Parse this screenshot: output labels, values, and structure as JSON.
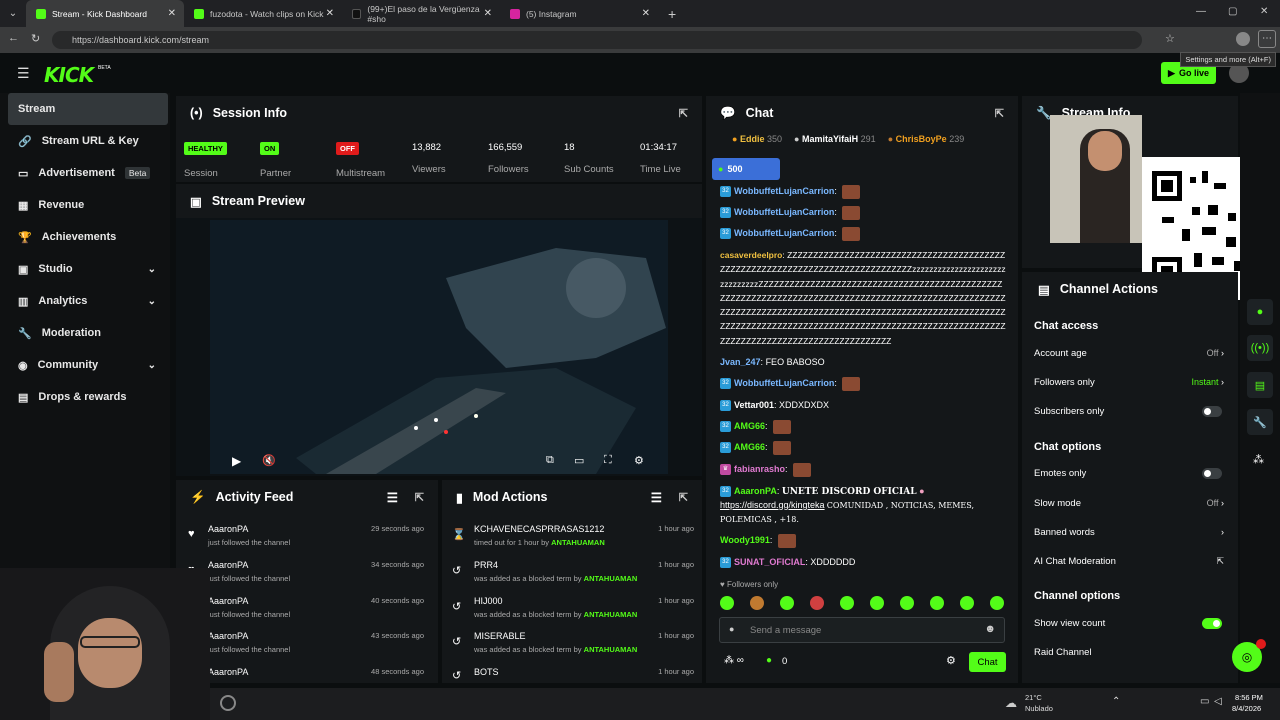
{
  "browser": {
    "tabs": [
      {
        "title": "Stream - Kick Dashboard",
        "color": "#53fc18",
        "active": true
      },
      {
        "title": "fuzodota - Watch clips on Kick",
        "color": "#53fc18",
        "active": false
      },
      {
        "title": "(99+)El paso de la Vergüenza #sho",
        "color": "#111111",
        "active": false
      },
      {
        "title": "(5) Instagram",
        "color": "#d6249f",
        "active": false
      }
    ],
    "url": "https://dashboard.kick.com/stream",
    "tooltip": "Settings and more (Alt+F)"
  },
  "topnav": {
    "logo": "KICK",
    "logo_sup": "BETA",
    "golive": "Go live"
  },
  "sidebar": {
    "items": [
      {
        "label": "Stream",
        "icon": "broadcast-icon",
        "active": true
      },
      {
        "label": "Stream URL & Key",
        "icon": "link-icon"
      },
      {
        "label": "Advertisement",
        "badge": "Beta",
        "icon": "ad-icon"
      },
      {
        "label": "Revenue",
        "icon": "revenue-icon"
      },
      {
        "label": "Achievements",
        "icon": "trophy-icon"
      },
      {
        "label": "Studio",
        "icon": "studio-icon",
        "chevron": true
      },
      {
        "label": "Analytics",
        "icon": "chart-icon",
        "chevron": true
      },
      {
        "label": "Moderation",
        "icon": "wrench-icon"
      },
      {
        "label": "Community",
        "icon": "community-icon",
        "chevron": true
      },
      {
        "label": "Drops & rewards",
        "icon": "gift-icon"
      }
    ]
  },
  "session": {
    "title": "Session Info",
    "session_pill": "HEALTHY",
    "session_label": "Session",
    "partner_pill": "ON",
    "partner_label": "Partner",
    "multistream_pill": "OFF",
    "multistream_label": "Multistream",
    "viewers": "13,882",
    "viewers_label": "Viewers",
    "followers": "166,559",
    "followers_label": "Followers",
    "subs": "18",
    "subs_label": "Sub Counts",
    "time": "01:34:17",
    "time_label": "Time Live"
  },
  "preview": {
    "title": "Stream Preview"
  },
  "activity": {
    "title": "Activity Feed",
    "rows": [
      {
        "name": "AaaronPA",
        "sub": "just followed the channel",
        "time": "29 seconds ago"
      },
      {
        "name": "AaaronPA",
        "sub": "just followed the channel",
        "time": "34 seconds ago"
      },
      {
        "name": "AaaronPA",
        "sub": "just followed the channel",
        "time": "40 seconds ago"
      },
      {
        "name": "AaaronPA",
        "sub": "just followed the channel",
        "time": "43 seconds ago"
      },
      {
        "name": "AaaronPA",
        "sub": "",
        "time": "48 seconds ago"
      }
    ]
  },
  "mod": {
    "title": "Mod Actions",
    "by": "ANTAHUAMAN",
    "rows": [
      {
        "name": "KCHAVENECASPRRASAS1212",
        "sub": "timed out for 1 hour by",
        "time": "1 hour ago"
      },
      {
        "name": "PRR4",
        "sub": "was added as a blocked term by",
        "time": "1 hour ago"
      },
      {
        "name": "HIJ000",
        "sub": "was added as a blocked term by",
        "time": "1 hour ago"
      },
      {
        "name": "MISERABLE",
        "sub": "was added as a blocked term by",
        "time": "1 hour ago"
      },
      {
        "name": "BOTS",
        "sub": "",
        "time": "1 hour ago"
      }
    ]
  },
  "chat": {
    "title": "Chat",
    "top": [
      {
        "name": "Eddie",
        "score": "350"
      },
      {
        "name": "MamitaYifaiH",
        "score": "291"
      },
      {
        "name": "ChrisBoyPe",
        "score": "239"
      }
    ],
    "goal": "500",
    "lines": [
      {
        "user": "WobbuffetLujanCarrion",
        "color": "#7ab8ff",
        "text": ""
      },
      {
        "user": "WobbuffetLujanCarrion",
        "color": "#7ab8ff",
        "text": ""
      },
      {
        "user": "WobbuffetLujanCarrion",
        "color": "#7ab8ff",
        "text": ""
      }
    ],
    "casa_user": "casaverdeelpro",
    "casa_text": "ZZZZZZZZZZZZZZZZZZZZZZZZZZZZZZZZZZZZZZZZZZZZZZZZZZZZZZZZZZZZZZZZZZZZZZZZZZZZZZZzzzzzzzzzzzzzzzzzzzzzzzzzzzzzzzZZZZZZZZZZZZZZZZZZZZZZZZZZZZZZZZZZZZZZZZZZZZZZZZZZZZZZZZZZZZZZZZZZZZZZZZZZZZZZZZZZZZZZZZZZZZZZZZZZZZZZZZZZZZZZZZZZZZZZZZZZZZZZZZZZZZZZZZZZZZZZZZZZZZZZZZZZZZZZZZZZZZZZZZZZZZZZZZZZZZZZZZZZZZZZZZZZZZZZZZZZZZZZZZZZZZZZZZZZZZZZZZZZZZZZZZZZZZZZZZZZZZZ",
    "jvan_user": "Jvan_247",
    "jvan_text": "FEO BABOSO",
    "wob4": "WobbuffetLujanCarrion",
    "vettar_user": "Vettar001",
    "vettar_text": "XDDXDXDX",
    "amg1": "AMG66",
    "amg2": "AMG66",
    "fabian": "fabianrasho",
    "aaron_user": "AaaronPA",
    "aaron_text": "UNETE DISCORD OFICIAL",
    "discord_link": "https://discord.gg/kingteka",
    "discord_rest": "COMUNIDAD , NOTICIAS, MEMES, POLEMICAS , +18.",
    "woody": "Woody1991",
    "sunat_user": "SUNAT_OFICIAL",
    "sunat_text": "XDDDDDD",
    "followers_only": "Followers only",
    "placeholder": "Send a message",
    "count": "0",
    "send": "Chat"
  },
  "streaminfo": {
    "title": "Stream Info"
  },
  "actions": {
    "title": "Channel Actions",
    "chat_access": "Chat access",
    "account_age": "Account age",
    "account_age_val": "Off",
    "followers_only": "Followers only",
    "followers_only_val": "Instant",
    "subs_only": "Subscribers only",
    "chat_options": "Chat options",
    "emotes_only": "Emotes only",
    "slow_mode": "Slow mode",
    "slow_mode_val": "Off",
    "banned": "Banned words",
    "ai": "AI Chat Moderation",
    "channel_options": "Channel options",
    "show_view": "Show view count",
    "raid": "Raid Channel"
  },
  "taskbar": {
    "temp": "21°C",
    "weather": "Nublado",
    "time": "8:56 PM",
    "date": "8/4/2026"
  },
  "colors": {
    "accent": "#53fc18",
    "bg": "#0b0e0f",
    "panel": "#141719"
  }
}
